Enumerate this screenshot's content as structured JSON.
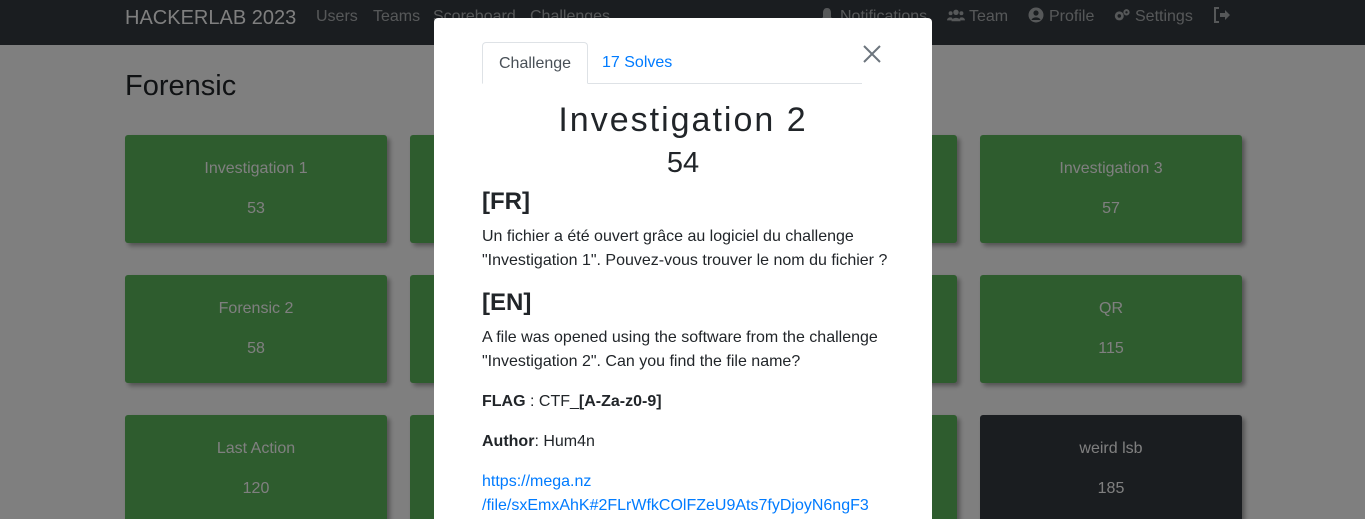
{
  "navbar": {
    "brand": "HACKERLAB 2023",
    "links": [
      "Users",
      "Teams",
      "Scoreboard",
      "Challenges"
    ],
    "right": [
      {
        "label": "Notifications",
        "icon": "bell-icon"
      },
      {
        "label": "Team",
        "icon": "users-icon"
      },
      {
        "label": "Profile",
        "icon": "user-circle-icon"
      },
      {
        "label": "Settings",
        "icon": "cogs-icon"
      },
      {
        "label": "",
        "icon": "logout-icon"
      }
    ]
  },
  "category": "Forensic",
  "cards": [
    {
      "name": "Investigation 1",
      "value": "53"
    },
    {
      "name": "Investigation 3",
      "value": "57"
    },
    {
      "name": "Forensic 2",
      "value": "58"
    },
    {
      "name": "QR",
      "value": "115"
    },
    {
      "name": "Last Action",
      "value": "120"
    },
    {
      "name": "weird lsb",
      "value": "185"
    }
  ],
  "modal": {
    "tabs": [
      "Challenge",
      "17 Solves"
    ],
    "title": "Investigation 2",
    "value": "54",
    "fr_heading": "[FR]",
    "fr_text": "Un fichier a été ouvert grâce au logiciel du challenge \"Investigation 1\". Pouvez-vous trouver le nom du fichier ?",
    "en_heading": "[EN]",
    "en_text": "A file was opened using the software from the challenge \"Investigation 2\". Can you find the file name?",
    "flag_label": "FLAG",
    "flag_sep": " : CTF_",
    "flag_format": "[A-Za-z0-9]",
    "author_label": "Author",
    "author_sep": ": ",
    "author": "Hum4n",
    "link_line1": "https://mega.nz",
    "link_line2": "/file/sxEmxAhK#2FLrWfkCOlFZeU9Ats7fyDjoyN6ngF3"
  },
  "colors": {
    "navbar": "#343a40",
    "card": "#5cb85c",
    "card_dark": "#343a40",
    "link": "#007bff"
  }
}
